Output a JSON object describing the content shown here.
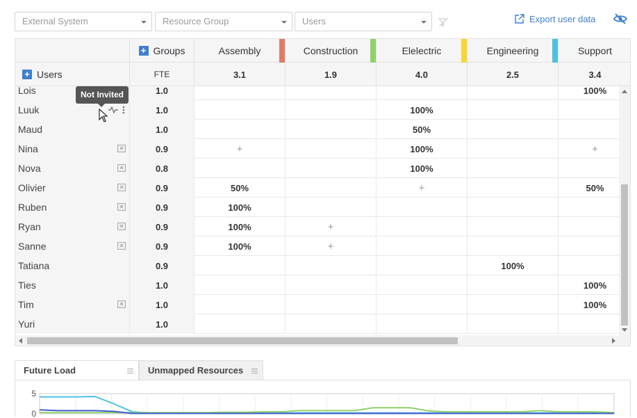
{
  "filters": {
    "external_system": "External System",
    "resource_group": "Resource Group",
    "users": "Users"
  },
  "export_label": "Export user data",
  "header": {
    "groups_label": "Groups",
    "users_label": "Users",
    "fte_label": "FTE",
    "columns": [
      {
        "name": "Assembly",
        "value": "3.1",
        "color": "#e07b66"
      },
      {
        "name": "Construction",
        "value": "1.9",
        "color": "#8fd16b"
      },
      {
        "name": "Elelectric",
        "value": "4.0",
        "color": "#f7d731"
      },
      {
        "name": "Engineering",
        "value": "2.5",
        "color": "#4fc0e0"
      },
      {
        "name": "Support",
        "value": "3.4",
        "color": ""
      }
    ]
  },
  "rows": [
    {
      "name": "Lois",
      "fte": "1.0",
      "x": false,
      "cells": [
        "",
        "",
        "",
        "",
        "100%"
      ]
    },
    {
      "name": "Luuk",
      "fte": "1.0",
      "x": true,
      "cells": [
        "",
        "",
        "100%",
        "",
        ""
      ]
    },
    {
      "name": "Maud",
      "fte": "1.0",
      "x": false,
      "cells": [
        "",
        "",
        "50%",
        "",
        ""
      ]
    },
    {
      "name": "Nina",
      "fte": "0.9",
      "x": true,
      "cells": [
        "+",
        "",
        "100%",
        "",
        "+"
      ]
    },
    {
      "name": "Nova",
      "fte": "0.8",
      "x": true,
      "cells": [
        "",
        "",
        "100%",
        "",
        ""
      ]
    },
    {
      "name": "Olivier",
      "fte": "0.9",
      "x": true,
      "cells": [
        "50%",
        "",
        "+",
        "",
        "50%"
      ]
    },
    {
      "name": "Ruben",
      "fte": "0.9",
      "x": true,
      "cells": [
        "100%",
        "",
        "",
        "",
        ""
      ]
    },
    {
      "name": "Ryan",
      "fte": "0.9",
      "x": true,
      "cells": [
        "100%",
        "+",
        "",
        "",
        ""
      ]
    },
    {
      "name": "Sanne",
      "fte": "0.9",
      "x": true,
      "cells": [
        "100%",
        "+",
        "",
        "",
        ""
      ]
    },
    {
      "name": "Tatiana",
      "fte": "0.9",
      "x": false,
      "cells": [
        "",
        "",
        "",
        "100%",
        ""
      ]
    },
    {
      "name": "Ties",
      "fte": "1.0",
      "x": false,
      "cells": [
        "",
        "",
        "",
        "",
        "100%"
      ]
    },
    {
      "name": "Tim",
      "fte": "1.0",
      "x": true,
      "cells": [
        "",
        "",
        "",
        "",
        "100%"
      ]
    },
    {
      "name": "Yuri",
      "fte": "1.0",
      "x": false,
      "cells": [
        "",
        "",
        "",
        "",
        ""
      ]
    }
  ],
  "tooltip": "Not Invited",
  "tabs": {
    "future_load": "Future Load",
    "unmapped": "Unmapped Resources"
  },
  "chart_data": {
    "type": "line",
    "ylim": [
      0,
      5
    ],
    "yticks": [
      "5",
      "0"
    ],
    "series": [
      {
        "color": "#4fc0e0",
        "values": [
          4.2,
          4.2,
          4.2,
          4.3,
          2.5,
          0.5,
          0.2,
          0.2,
          0.2,
          0.2,
          0.2,
          0.2,
          0.2,
          0.2,
          0.2,
          0.2,
          0.2,
          0.2,
          0.2,
          0.2,
          0.2,
          0.2,
          0.2,
          0.2,
          0.2,
          0.2,
          0.2,
          0.2,
          0.2,
          0.2,
          0.2,
          0.2
        ]
      },
      {
        "color": "#8fd16b",
        "values": [
          0.3,
          0.3,
          0.3,
          0.3,
          0.3,
          0.3,
          0.3,
          0.3,
          0.3,
          0.3,
          0.4,
          0.4,
          0.5,
          0.5,
          0.8,
          0.8,
          0.8,
          0.8,
          1.5,
          1.5,
          1.5,
          0.7,
          0.5,
          0.5,
          0.5,
          0.5,
          0.5,
          0.8,
          0.5,
          0.5,
          0.5,
          0.3
        ]
      },
      {
        "color": "#3f5fcd",
        "values": [
          1.0,
          0.8,
          0.8,
          0.8,
          0.6,
          0.1,
          0.1,
          0.1,
          0.1,
          0.1,
          0.1,
          0.1,
          0.1,
          0.1,
          0.1,
          0.1,
          0.1,
          0.1,
          0.1,
          0.1,
          0.1,
          0.1,
          0.1,
          0.1,
          0.1,
          0.1,
          0.1,
          0.1,
          0.1,
          0.1,
          0.1,
          0.1
        ]
      }
    ]
  }
}
